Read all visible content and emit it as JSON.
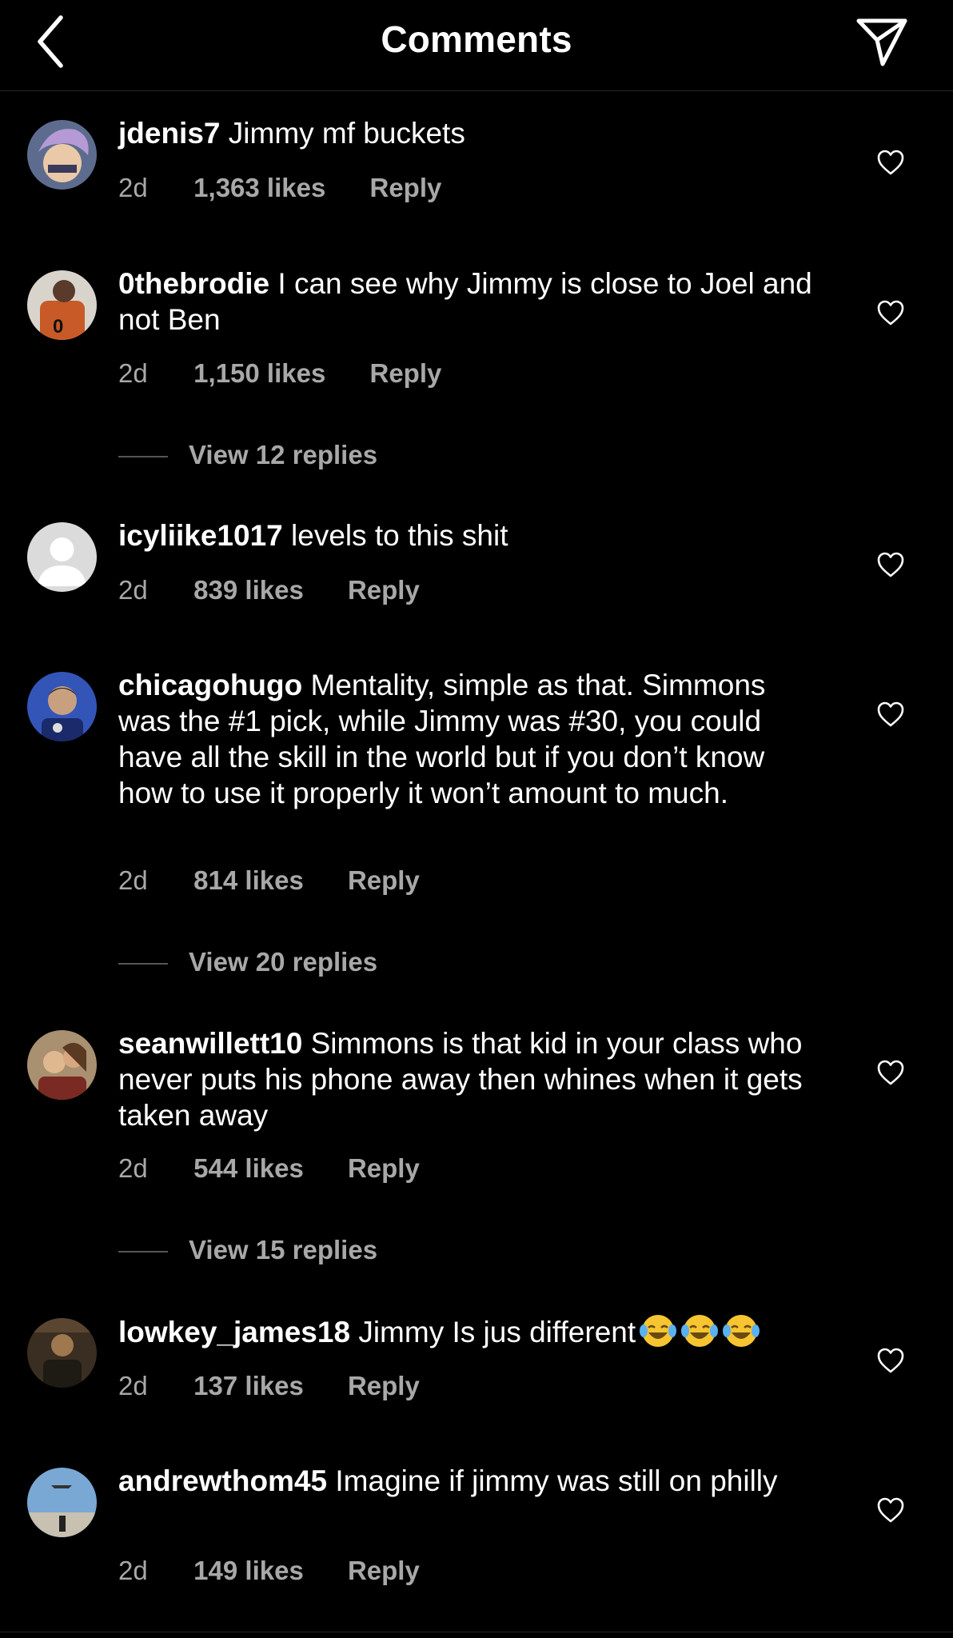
{
  "header": {
    "title": "Comments",
    "back_icon": "chevron-left-icon",
    "share_icon": "paper-plane-icon"
  },
  "comments": [
    {
      "username": "jdenis7",
      "text": "Jimmy mf buckets",
      "time": "2d",
      "likes": "1,363 likes",
      "reply": "Reply",
      "avatar_color": "#5a6a8a"
    },
    {
      "username": "0thebrodie",
      "text": "I can see why Jimmy is close to Joel and not Ben",
      "time": "2d",
      "likes": "1,150 likes",
      "reply": "Reply",
      "view_replies": "View 12 replies",
      "avatar_color": "#b4562c"
    },
    {
      "username": "icyliike1017",
      "text": "levels to this shit",
      "time": "2d",
      "likes": "839 likes",
      "reply": "Reply",
      "avatar_color": "#dbdbdb"
    },
    {
      "username": "chicagohugo",
      "text": "Mentality, simple as that. Simmons was the #1 pick, while Jimmy was #30, you could have all the skill in the world but if you don’t know how to use it properly it won’t amount to much.",
      "time": "2d",
      "likes": "814 likes",
      "reply": "Reply",
      "view_replies": "View 20 replies",
      "avatar_color": "#2a48a8"
    },
    {
      "username": "seanwillett10",
      "text": "Simmons is that kid in your class who never puts his phone away then whines when it gets taken away",
      "time": "2d",
      "likes": "544 likes",
      "reply": "Reply",
      "view_replies": "View 15 replies",
      "avatar_color": "#7a5a48"
    },
    {
      "username": "lowkey_james18",
      "text": "Jimmy Is jus different",
      "emoji": "😂😂😂",
      "time": "2d",
      "likes": "137 likes",
      "reply": "Reply",
      "avatar_color": "#4a3a2a"
    },
    {
      "username": "andrewthom45",
      "text": "Imagine if jimmy was still on philly",
      "time": "2d",
      "likes": "149 likes",
      "reply": "Reply",
      "avatar_color": "#6f9ec8"
    }
  ],
  "colors": {
    "background": "#000000",
    "text": "#ffffff",
    "secondary": "#a8a8a8"
  }
}
